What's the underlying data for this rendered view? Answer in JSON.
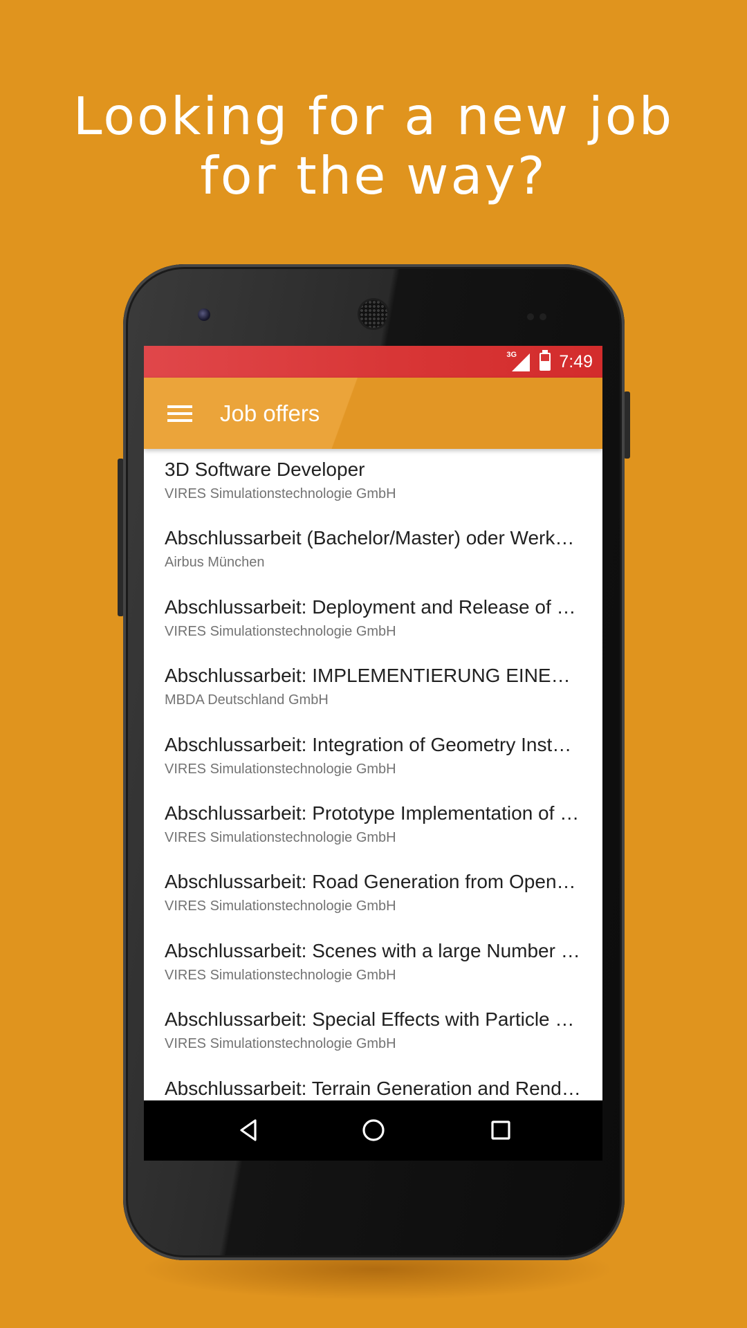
{
  "headline": {
    "line1": "Looking for a new job",
    "line2": "for the way?"
  },
  "status_bar": {
    "network": "3G",
    "time": "7:49"
  },
  "app_bar": {
    "title": "Job offers"
  },
  "jobs": [
    {
      "title": "3D Software Developer",
      "company": "VIRES Simulationstechnologie GmbH"
    },
    {
      "title": "Abschlussarbeit (Bachelor/Master) oder Werkstudent",
      "company": "Airbus München"
    },
    {
      "title": "Abschlussarbeit: Deployment and Release of Software",
      "company": "VIRES Simulationstechnologie GmbH"
    },
    {
      "title": "Abschlussarbeit: IMPLEMENTIERUNG EINES SIMULATIONSMODELLS",
      "company": "MBDA Deutschland GmbH"
    },
    {
      "title": "Abschlussarbeit: Integration of Geometry Instancing",
      "company": "VIRES Simulationstechnologie GmbH"
    },
    {
      "title": "Abschlussarbeit: Prototype Implementation of a Renderer",
      "company": "VIRES Simulationstechnologie GmbH"
    },
    {
      "title": "Abschlussarbeit: Road Generation from OpenStreetMap Data",
      "company": "VIRES Simulationstechnologie GmbH"
    },
    {
      "title": "Abschlussarbeit: Scenes with a large Number of Objects",
      "company": "VIRES Simulationstechnologie GmbH"
    },
    {
      "title": "Abschlussarbeit: Special Effects with Particle Systems",
      "company": "VIRES Simulationstechnologie GmbH"
    },
    {
      "title": "Abschlussarbeit: Terrain Generation and Rendering",
      "company": ""
    }
  ],
  "icons": {
    "menu": "hamburger-menu-icon",
    "back": "back-triangle-icon",
    "home": "home-circle-icon",
    "recent": "recent-apps-square-icon",
    "signal": "signal-3g-icon",
    "battery": "battery-charging-icon"
  },
  "colors": {
    "background": "#e0941e",
    "status_bar": "#d83636",
    "app_bar": "#e29625",
    "nav_bar": "#000000"
  }
}
